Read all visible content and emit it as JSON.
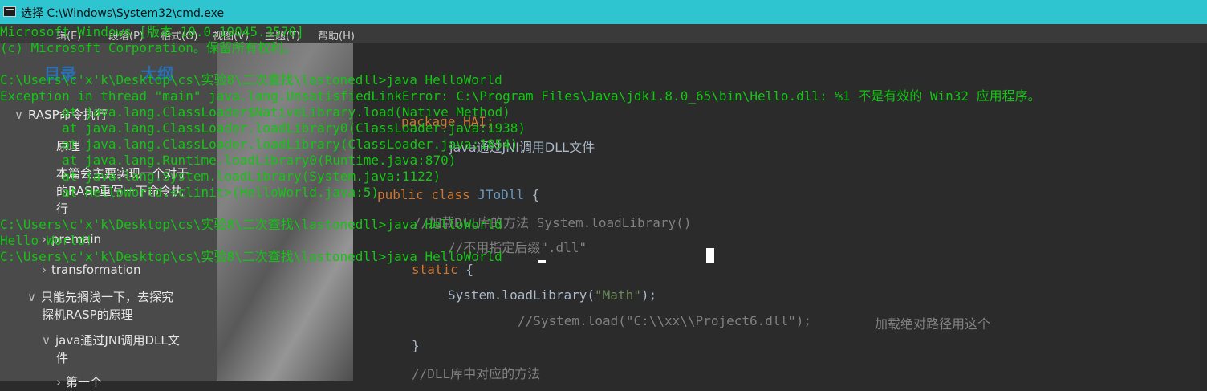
{
  "window": {
    "title": "选择 C:\\Windows\\System32\\cmd.exe"
  },
  "background_app": {
    "menu": [
      "辑(E)",
      "段落(P)",
      "格式(O)",
      "视图(V)",
      "主题(T)",
      "帮助(H)"
    ],
    "tabs": [
      "目录",
      "大纲"
    ],
    "sidebar": [
      {
        "label": "RASP命令执行",
        "arrow": "∨"
      },
      {
        "label": "原理",
        "arrow": ""
      },
      {
        "label": "本篇会主要实现一个对于",
        "arrow": ""
      },
      {
        "label": "的RASP重写一下命令执",
        "arrow": ""
      },
      {
        "label": "行",
        "arrow": ""
      },
      {
        "label": "premain",
        "arrow": "›"
      },
      {
        "label": "transformation",
        "arrow": "›"
      },
      {
        "label": "只能先搁浅一下，去探究",
        "arrow": "∨"
      },
      {
        "label": "探机RASP的原理",
        "arrow": ""
      },
      {
        "label": "java通过JNI调用DLL文",
        "arrow": "∨"
      },
      {
        "label": "件",
        "arrow": ""
      },
      {
        "label": "第一个",
        "arrow": "›"
      }
    ],
    "code": {
      "package": "package HAI;",
      "heading": "java通过JNI调用DLL文件",
      "class_kw": "public class ",
      "class_name": "JToDll",
      "class_brace": " {",
      "comment1": "//加载Dll库的方法 System.loadLibrary()",
      "comment2": "//不用指定后缀\".dll\"",
      "static_kw": "static",
      "static_brace": " {",
      "load_call": "System.loadLibrary(",
      "load_arg": "\"Math\"",
      "load_end": ");",
      "load_abs": "//System.load(\"C:\\\\xx\\\\Project6.dll\");",
      "load_abs_note": "加载绝对路径用这个",
      "close_brace": "}",
      "comment3": "//DLL库中对应的方法"
    }
  },
  "console": {
    "lines": [
      "Microsoft Windows [版本 10.0.19045.3570]",
      "(c) Microsoft Corporation。保留所有权利。",
      "",
      "C:\\Users\\c'x'k\\Desktop\\cs\\实验8\\二次查找\\lastonedll>java HelloWorld",
      "Exception in thread \"main\" java.lang.UnsatisfiedLinkError: C:\\Program Files\\Java\\jdk1.8.0_65\\bin\\Hello.dll: %1 不是有效的 Win32 应用程序。",
      "        at java.lang.ClassLoader$NativeLibrary.load(Native Method)",
      "        at java.lang.ClassLoader.loadLibrary0(ClassLoader.java:1938)",
      "        at java.lang.ClassLoader.loadLibrary(ClassLoader.java:1854)",
      "        at java.lang.Runtime.loadLibrary0(Runtime.java:870)",
      "        at java.lang.System.loadLibrary(System.java:1122)",
      "        at HelloWorld.<clinit>(HelloWorld.java:5)",
      "",
      "C:\\Users\\c'x'k\\Desktop\\cs\\实验8\\二次查找\\lastonedll>java HelloWorld",
      "Hello World!",
      "C:\\Users\\c'x'k\\Desktop\\cs\\实验8\\二次查找\\lastonedll>java HelloWorld"
    ]
  },
  "colors": {
    "titlebar": "#2ec4d0",
    "console_text": "#13c513",
    "background": "#2b2b2b"
  }
}
